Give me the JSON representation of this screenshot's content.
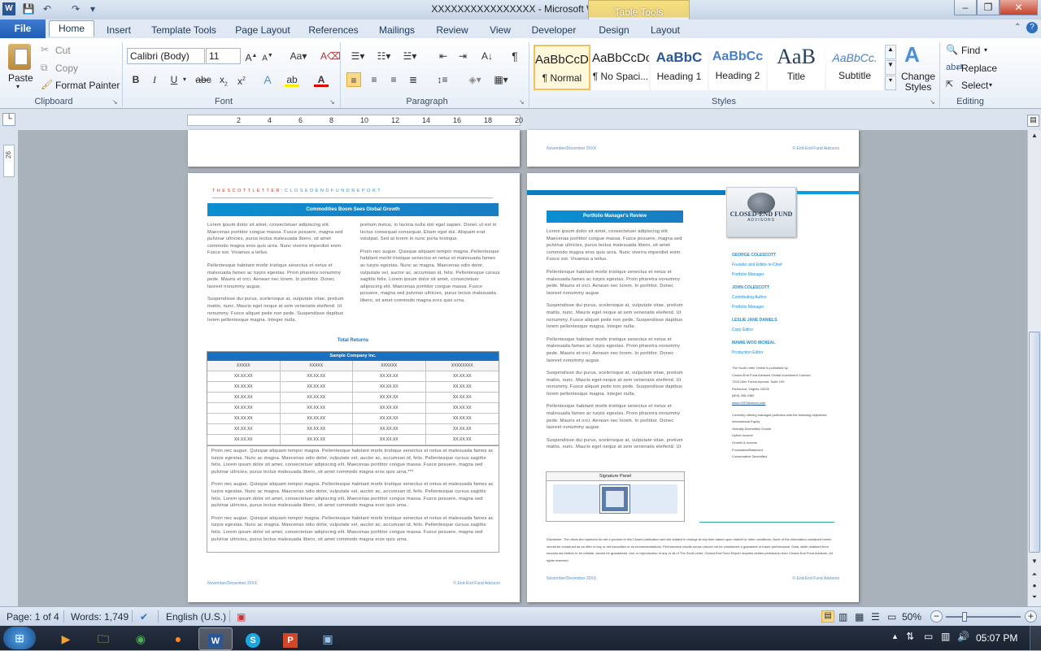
{
  "window": {
    "title": "XXXXXXXXXXXXXXXX  -  Microsoft Word",
    "context_tab_group": "Table Tools",
    "controls": {
      "minimize": "–",
      "restore": "❐",
      "close": "✕"
    }
  },
  "tabs": [
    "File",
    "Home",
    "Insert",
    "Template Tools",
    "Page Layout",
    "References",
    "Mailings",
    "Review",
    "View",
    "Developer",
    "Design",
    "Layout"
  ],
  "ribbon": {
    "clipboard": {
      "paste": "Paste",
      "cut": "Cut",
      "copy": "Copy",
      "format_painter": "Format Painter",
      "label": "Clipboard"
    },
    "font": {
      "name": "Calibri (Body)",
      "size": "11",
      "label": "Font"
    },
    "paragraph": {
      "label": "Paragraph"
    },
    "styles": {
      "items": [
        {
          "preview": "AaBbCcDc",
          "name": "¶ Normal"
        },
        {
          "preview": "AaBbCcDc",
          "name": "¶ No Spaci..."
        },
        {
          "preview": "AaBbC",
          "name": "Heading 1"
        },
        {
          "preview": "AaBbCc",
          "name": "Heading 2"
        },
        {
          "preview": "AaB",
          "name": "Title"
        },
        {
          "preview": "AaBbCc.",
          "name": "Subtitle"
        }
      ],
      "change_styles": "Change Styles",
      "label": "Styles"
    },
    "editing": {
      "find": "Find",
      "replace": "Replace",
      "select": "Select",
      "label": "Editing"
    }
  },
  "ruler": {
    "ticks": [
      "2",
      "4",
      "6",
      "8",
      "10",
      "12",
      "14",
      "16",
      "18",
      "20"
    ]
  },
  "document": {
    "prev_page_footer_left": "November/December 20XX",
    "prev_page_footer_right": "© End-End Fund Advisors",
    "page3": {
      "header_left": "T H E   S C O T T   L E T T E R :",
      "header_right": "C L O S E D   E N D   F U N D   R E P O R T",
      "banner": "Commodities Boom Sees Global Growth",
      "section_title": "Total Returns",
      "table_title": "Sample Company Inc.",
      "table_headers": [
        "XXXXX",
        "XXXXX",
        "XXXXXX",
        "XXXXXXXX"
      ],
      "table_cell": "XX.XX.XX",
      "lorem1": "Lorem ipsum dolor sit amet, consectetuer adipiscing elit. Maecenas porttitor congue massa. Fusce posuere, magna sed pulvinar ultricies, purus lectus malesuada libero, sit amet commodo magna eros quis urna. Nunc viverra imperdiet enim. Fusce est. Vivamus a tellus.",
      "lorem2": "Pellentesque habitant morbi tristique senectus et netus et malesuada fames ac turpis egestas. Proin pharetra nonummy pede. Mauris et orci. Aenean nec lorem. In porttitor. Donec laoreet nonummy augue.",
      "lorem3": "Suspendisse dui purus, scelerisque at, vulputate vitae, pretium mattis, nunc. Mauris eget neque at sem venenatis eleifend. Ut nonummy. Fusce aliquet pede non pede. Suspendisse dapibus lorem pellentesque magna. Integer nulla.",
      "lorem4": "pretium metus, in lacinia nulla nisl eget sapien. Donec ut est in lectus consequat consequat. Etiam eget dui. Aliquam erat volutpat. Sed at lorem in nunc porta tristique.",
      "lorem5": "Proin nec augue. Quisque aliquam tempor magna. Pellentesque habitant morbi tristique senectus et netus et malesuada fames ac turpis egestas. Nunc ac magna. Maecenas odio dolor, vulputate vel, auctor ac, accumsan id, felis. Pellentesque cursus sagittis felis. Lorem ipsum dolor sit amet, consectetuer adipiscing elit. Maecenas porttitor congue massa. Fusce posuere, magna sed pulvinar ultricies, purus lectus malesuada libero, sit amet commodo magna eros quis urna.",
      "lorem6": "Proin nec augue. Quisque aliquam tempor magna. Pellentesque habitant morbi tristique senectus et netus et malesuada fames ac turpis egestas. Nunc ac magna. Maecenas odio dolor, vulputate vel, auctor ac, accumsan id, felis. Pellentesque cursus sagittis felis. Lorem ipsum dolor sit amet, consectetuer adipiscing elit. Maecenas porttitor congue massa. Fusce posuere, magna sed pulvinar ultricies, purus lectus malesuada libero, sit amet commodo magna eros quis urna.***",
      "footer_left": "November/December 20XX",
      "footer_right": "© End-End Fund Advisors"
    },
    "page4": {
      "banner": "Portfolio Manager's Review",
      "logo_line1": "CLOSED-END FUND",
      "logo_line2": "ADVISORS",
      "staff": [
        {
          "name": "GEORGE COLESCOTT",
          "roles": [
            "Founder and Editor-in-Chief",
            "Portfolio Manager"
          ]
        },
        {
          "name": "JOHN COLESCOTT",
          "roles": [
            "Contributing Author",
            "Portfolio Manager"
          ]
        },
        {
          "name": "LESLIE JANE DANIELS",
          "roles": [
            "Copy Editor"
          ]
        },
        {
          "name": "MAMIE WOO MCNEAL",
          "roles": [
            "Production Editor"
          ]
        }
      ],
      "publisher": [
        "The Scott Letter Online is published by",
        "Closed-End Fund Advisors Global Investment Counsel",
        "7204 Glen Forest Avenue, Suite 105",
        "Richmond, Virginia 23226",
        "(804) 288-2482",
        "www.CEFAdvisors.com"
      ],
      "portfolios": [
        "Currently offering managed portfolios with the following objectives:",
        "International Equity",
        "Globally Diversified Growth",
        "Hybrid Income",
        "Growth & Income",
        "Foundation/Balanced",
        "Conservative Diversified"
      ],
      "signature_label": "Signature Panel",
      "disclaimer": "Disclaimer: The views and opinions for are a product of this Closed publication and are subject to change at any time based upon market or other conditions. None of the information contained herein should be construed as an offer to buy or sell securities or an recommendations. Performance results shown should not be considered a guarantee of future performance. Data, while obtained from sources we believe to be reliable, cannot be guaranteed. Use or reproduction of any or all of The Scott Letter: Closed-End Fund Report requires written permission from Closed-End Fund Advisors. All rights reserved.",
      "footer_left": "November/December 20XX",
      "footer_right": "© End-End Fund Advisors"
    }
  },
  "status": {
    "page": "Page: 1 of 4",
    "words": "Words: 1,749",
    "language": "English (U.S.)",
    "zoom": "50%"
  },
  "taskbar": {
    "time": "05:07 PM"
  }
}
